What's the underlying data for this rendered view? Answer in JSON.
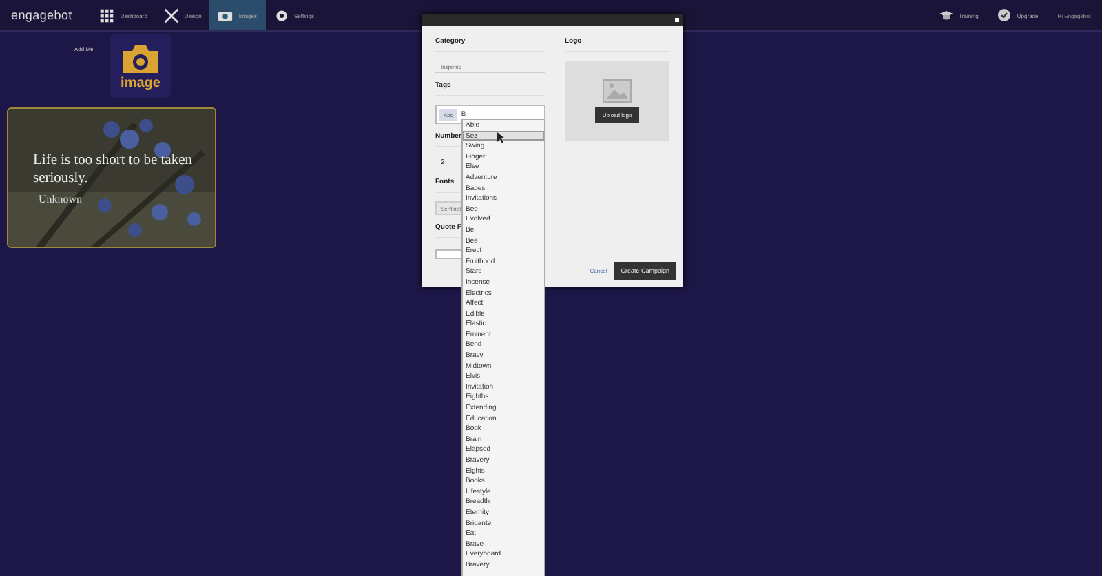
{
  "nav": {
    "logo": "engagebot",
    "items": [
      {
        "label": "Dashboard",
        "selected": false
      },
      {
        "label": "Design",
        "selected": false
      },
      {
        "label": "Images",
        "selected": true
      },
      {
        "label": "Settings",
        "selected": false
      }
    ],
    "right": [
      "Training",
      "Upgrade"
    ],
    "greeting": "Hi Engagebot"
  },
  "sidebar": {
    "label": "Add Me",
    "tile_caption": "image"
  },
  "quote_card": {
    "quote": "Life is too short to be taken seriously.",
    "author": "Unknown"
  },
  "modal": {
    "category": {
      "label": "Category",
      "value": "Inspiring"
    },
    "tags": {
      "label": "Tags",
      "chips": [
        "Abc"
      ],
      "value": "B"
    },
    "number": {
      "label": "Number",
      "value": "2"
    },
    "fonts": {
      "label": "Fonts",
      "value": "Sentinel"
    },
    "quote_font": {
      "label": "Quote F"
    },
    "logo": {
      "label": "Logo",
      "button": "Upload logo"
    },
    "cancel": "Cancel",
    "submit": "Create Campaign"
  },
  "suggestions": [
    {
      "label": "Able",
      "selected": false
    },
    {
      "label": "Sez",
      "selected": true
    },
    {
      "label": "Swing",
      "selected": false
    },
    {
      "label": "Finger",
      "selected": false
    },
    {
      "label": "Else",
      "selected": false
    },
    {
      "label": "Adventure",
      "selected": false
    },
    {
      "label": "Babes",
      "selected": false
    },
    {
      "label": "Invitations",
      "selected": false
    },
    {
      "label": "Bee",
      "selected": false
    },
    {
      "label": "Evolved",
      "selected": false
    },
    {
      "label": "Be",
      "selected": false
    },
    {
      "label": "Bee",
      "selected": false
    },
    {
      "label": "Erect",
      "selected": false
    },
    {
      "label": "Fruithood",
      "selected": false
    },
    {
      "label": "Stars",
      "selected": false
    },
    {
      "label": "Incense",
      "selected": false
    },
    {
      "label": "Electrics",
      "selected": false
    },
    {
      "label": "Affect",
      "selected": false
    },
    {
      "label": "Edible",
      "selected": false
    },
    {
      "label": "Elastic",
      "selected": false
    },
    {
      "label": "Eminent",
      "selected": false
    },
    {
      "label": "Bend",
      "selected": false
    },
    {
      "label": "Bravy",
      "selected": false
    },
    {
      "label": "Midtown",
      "selected": false
    },
    {
      "label": "Elvis",
      "selected": false
    },
    {
      "label": "Invitation",
      "selected": false
    },
    {
      "label": "Eighths",
      "selected": false
    },
    {
      "label": "Extending",
      "selected": false
    },
    {
      "label": "Education",
      "selected": false
    },
    {
      "label": "Book",
      "selected": false
    },
    {
      "label": "Brain",
      "selected": false
    },
    {
      "label": "Elapsed",
      "selected": false
    },
    {
      "label": "Bravery",
      "selected": false
    },
    {
      "label": "Eights",
      "selected": false
    },
    {
      "label": "Books",
      "selected": false
    },
    {
      "label": "Lifestyle",
      "selected": false
    },
    {
      "label": "Breadth",
      "selected": false
    },
    {
      "label": "Eternity",
      "selected": false
    },
    {
      "label": "Brigante",
      "selected": false
    },
    {
      "label": "Eat",
      "selected": false
    },
    {
      "label": "Brave",
      "selected": false
    },
    {
      "label": "Everyboard",
      "selected": false
    },
    {
      "label": "Bravery",
      "selected": false
    }
  ]
}
